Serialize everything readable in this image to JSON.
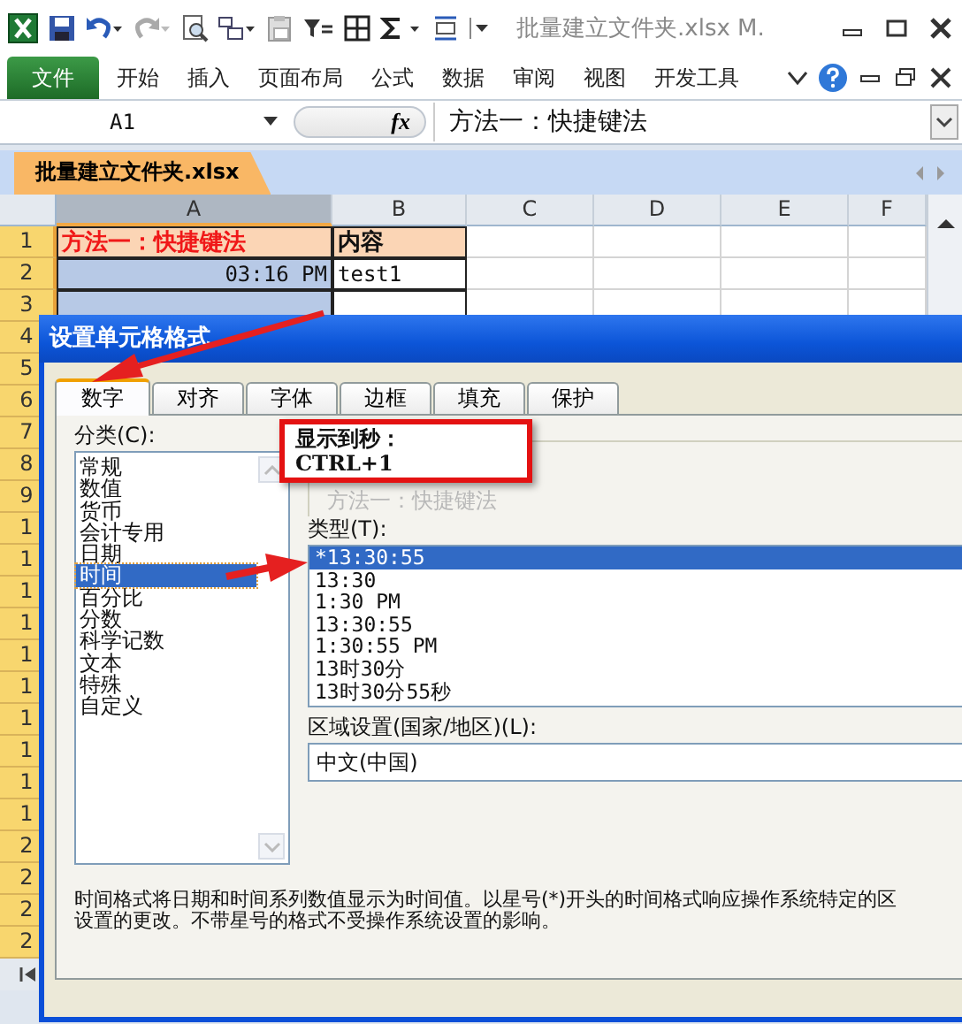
{
  "window": {
    "title": "批量建立文件夹.xlsx M."
  },
  "ribbon_tabs": [
    {
      "label": "文件",
      "kind": "file"
    },
    {
      "label": "开始",
      "kind": "tab"
    },
    {
      "label": "插入",
      "kind": "tab"
    },
    {
      "label": "页面布局",
      "kind": "tab"
    },
    {
      "label": "公式",
      "kind": "tab"
    },
    {
      "label": "数据",
      "kind": "tab"
    },
    {
      "label": "审阅",
      "kind": "tab"
    },
    {
      "label": "视图",
      "kind": "tab"
    },
    {
      "label": "开发工具",
      "kind": "tab"
    }
  ],
  "formula_bar": {
    "name_box": "A1",
    "fx_label": "fx",
    "formula": "方法一：快捷键法"
  },
  "workbook_tab": {
    "label": "批量建立文件夹.xlsx"
  },
  "sheet": {
    "columns": [
      {
        "label": "A",
        "selected": true
      },
      {
        "label": "B",
        "selected": false
      },
      {
        "label": "C",
        "selected": false
      },
      {
        "label": "D",
        "selected": false
      },
      {
        "label": "E",
        "selected": false
      },
      {
        "label": "F",
        "selected": false
      }
    ],
    "row_headers": [
      "1",
      "2",
      "3",
      "4",
      "5",
      "6",
      "7",
      "8",
      "9",
      "1",
      "1",
      "1",
      "1",
      "1",
      "1",
      "1",
      "1",
      "1",
      "1",
      "2",
      "2",
      "2",
      "2"
    ],
    "rows": [
      {
        "cells": [
          {
            "text": "方法一：快捷键法",
            "kind": "title",
            "selected": false
          },
          {
            "text": "内容",
            "kind": "heading",
            "selected": false
          }
        ]
      },
      {
        "cells": [
          {
            "text": "03:16 PM",
            "kind": "time",
            "selected": true
          },
          {
            "text": "test1",
            "kind": "plain",
            "selected": false
          }
        ]
      },
      {
        "cells": [
          {
            "kind": "plain",
            "selected": true
          },
          {
            "kind": "plain",
            "selected": false
          }
        ]
      }
    ]
  },
  "dialog": {
    "title": "设置单元格格式",
    "tabs": [
      {
        "label": "数字",
        "selected": true
      },
      {
        "label": "对齐",
        "selected": false
      },
      {
        "label": "字体",
        "selected": false
      },
      {
        "label": "边框",
        "selected": false
      },
      {
        "label": "填充",
        "selected": false
      },
      {
        "label": "保护",
        "selected": false
      }
    ],
    "category_label": "分类(C):",
    "categories": [
      {
        "label": "常规",
        "selected": false
      },
      {
        "label": "数值",
        "selected": false
      },
      {
        "label": "货币",
        "selected": false
      },
      {
        "label": "会计专用",
        "selected": false
      },
      {
        "label": "日期",
        "selected": false
      },
      {
        "label": "时间",
        "selected": true
      },
      {
        "label": "百分比",
        "selected": false
      },
      {
        "label": "分数",
        "selected": false
      },
      {
        "label": "科学记数",
        "selected": false
      },
      {
        "label": "文本",
        "selected": false
      },
      {
        "label": "特殊",
        "selected": false
      },
      {
        "label": "自定义",
        "selected": false
      }
    ],
    "sample_text": "方法一：快捷键法",
    "type_label": "类型(T):",
    "types": [
      {
        "label": "*13:30:55",
        "selected": true
      },
      {
        "label": "13:30",
        "selected": false
      },
      {
        "label": "1:30 PM",
        "selected": false
      },
      {
        "label": "13:30:55",
        "selected": false
      },
      {
        "label": "1:30:55 PM",
        "selected": false
      },
      {
        "label": "13时30分",
        "selected": false
      },
      {
        "label": "13时30分55秒",
        "selected": false
      }
    ],
    "locale_label": "区域设置(国家/地区)(L):",
    "locale": "中文(中国)",
    "description": [
      "时间格式将日期和时间系列数值显示为时间值。以星号(*)开头的时间格式响应操作系统特定的区",
      "设置的更改。不带星号的格式不受操作系统设置的影响。"
    ]
  },
  "callout": {
    "lines": [
      "显示到秒：",
      "CTRL+1"
    ]
  }
}
